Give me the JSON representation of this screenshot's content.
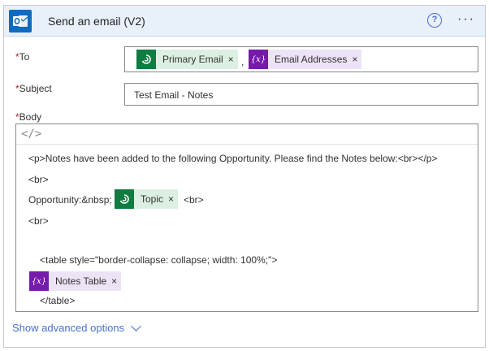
{
  "header": {
    "title": "Send an email (V2)",
    "help_glyph": "?",
    "more_glyph": "···",
    "icon": "outlook-mail-icon",
    "accent": "#0f6cbd"
  },
  "fields": {
    "to": {
      "label": "To",
      "required_mark": "*",
      "tokens": [
        {
          "label": "Primary Email",
          "type": "dataverse",
          "close": "×"
        },
        {
          "label": "Email Addresses",
          "type": "expression",
          "close": "×"
        }
      ],
      "separator": ","
    },
    "subject": {
      "label": "Subject",
      "required_mark": "*",
      "value": "Test Email - Notes"
    },
    "body": {
      "label": "Body",
      "required_mark": "*",
      "code_toggle": "</>",
      "lines": {
        "l1": "<p>Notes have been added to the following Opportunity. Please find the Notes below:<br></p>",
        "l2": "<br>",
        "l3_prefix": "Opportunity:&nbsp;",
        "l3_suffix": "<br>",
        "l4": "<br>",
        "l5": "<table style=\"border-collapse: collapse; width: 100%;\">",
        "l7": "</table>"
      },
      "tokens": {
        "topic": {
          "label": "Topic",
          "type": "dataverse",
          "close": "×"
        },
        "notes_table": {
          "label": "Notes Table",
          "type": "expression",
          "close": "×"
        }
      }
    }
  },
  "footer": {
    "advanced_label": "Show advanced options"
  },
  "colors": {
    "dataverse_token_bg": "#dbf0e3",
    "dataverse_icon_bg": "#107c41",
    "expression_token_bg": "#ede3f6",
    "expression_icon_bg": "#7719aa",
    "link": "#4a6fd1",
    "required": "#a4262c"
  },
  "icons": {
    "dataverse": "dataverse-icon",
    "expression": "expression-fx-icon"
  },
  "expression_glyph": "{x}"
}
